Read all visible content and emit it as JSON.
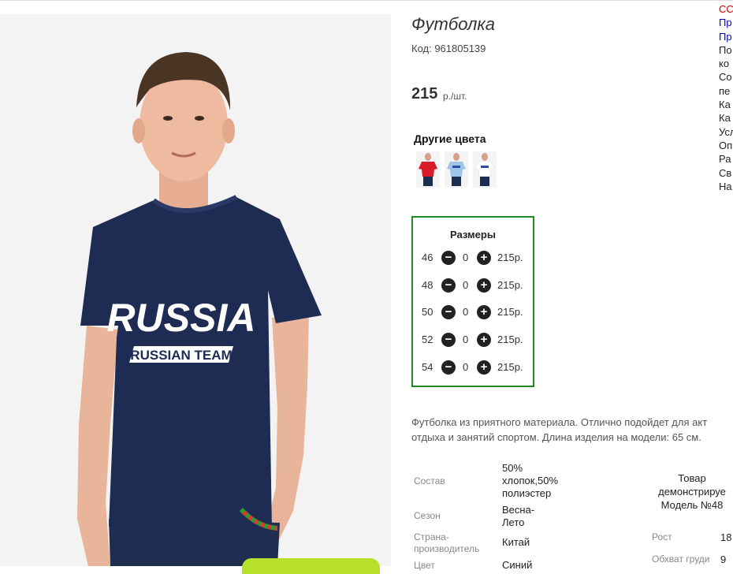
{
  "product": {
    "title": "Футболка",
    "code": "Код: 961805139",
    "price": "215",
    "price_unit": "р./шт.",
    "shirt_print": {
      "line1": "RUSSIA",
      "line2": "RUSSIAN TEAM"
    }
  },
  "other_colors": {
    "title": "Другие цвета",
    "items": [
      {
        "name": "red-shirt-thumb",
        "color": "#d81c2a"
      },
      {
        "name": "lightblue-shirt-thumb",
        "color": "#9fc6ea"
      },
      {
        "name": "white-shirt-thumb",
        "color": "#f4f4f4"
      }
    ]
  },
  "sizes": {
    "title": "Размеры",
    "rows": [
      {
        "size": "46",
        "qty": "0",
        "price": "215р."
      },
      {
        "size": "48",
        "qty": "0",
        "price": "215р."
      },
      {
        "size": "50",
        "qty": "0",
        "price": "215р."
      },
      {
        "size": "52",
        "qty": "0",
        "price": "215р."
      },
      {
        "size": "54",
        "qty": "0",
        "price": "215р."
      }
    ],
    "minus_icon": "minus-circle-icon",
    "plus_icon": "plus-circle-icon"
  },
  "description": {
    "line1": "Футболка из приятного материала. Отлично подойдет для акт",
    "line2": "отдыха и занятий спортом. Длина изделия на модели: 65 см."
  },
  "specs": {
    "composition_label": "Состав",
    "composition_value": "50% хлопок,50% полиэстер",
    "season_label": "Сезон",
    "season_value": "Весна-Лето",
    "country_label": "Страна-производитель",
    "country_value": "Китай",
    "color_label": "Цвет",
    "color_value": "Синий"
  },
  "model_info": {
    "note_line1": "Товар",
    "note_line2": "демонстрируе",
    "note_line3": "Модель №48",
    "height_label": "Рост",
    "height_value": "18",
    "chest_label": "Обхват груди",
    "chest_value": "9"
  },
  "side_nav": {
    "items": [
      "СС",
      "Пр",
      "Пр",
      "По",
      "ко",
      "Со",
      "пе",
      "Ка",
      "Ка",
      "Усл",
      "Оп",
      "Ра",
      "Св",
      "На"
    ]
  },
  "colors": {
    "accent_border": "#1d8b1d",
    "cart_button": "#b7e02a",
    "shirt": "#1e2b52"
  }
}
